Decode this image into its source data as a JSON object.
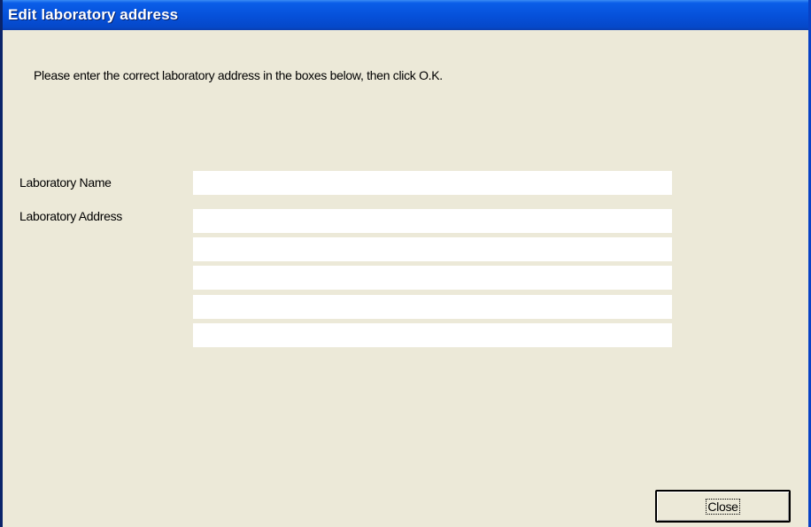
{
  "window": {
    "title": "Edit laboratory address"
  },
  "instruction": "Please enter the correct laboratory address in the boxes below, then click O.K.",
  "form": {
    "name_label": "Laboratory Name",
    "name_value": "",
    "address_label": "Laboratory Address",
    "address_lines": [
      "",
      "",
      "",
      "",
      ""
    ]
  },
  "buttons": {
    "close_label": "Close"
  },
  "colors": {
    "titlebar": "#0650d9",
    "dialog_background": "#ece9d8",
    "field_background": "#ffffff"
  }
}
